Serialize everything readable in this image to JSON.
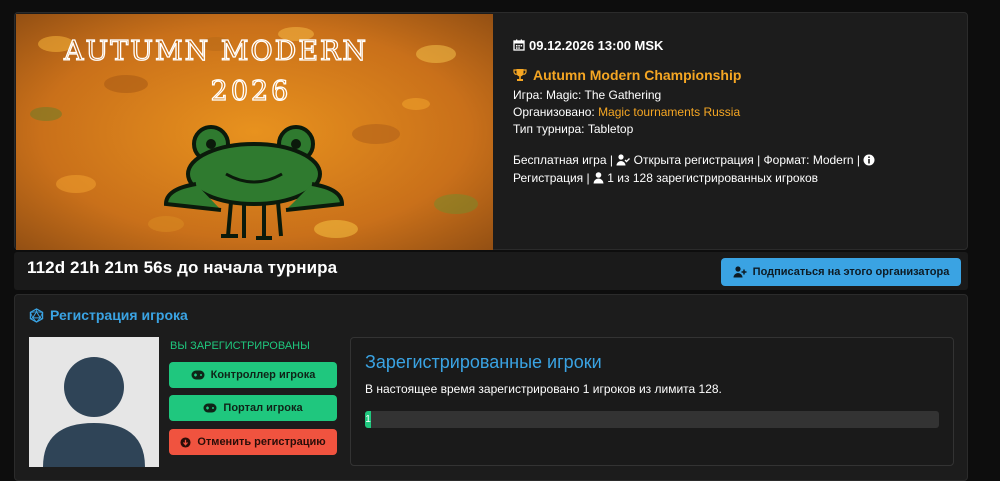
{
  "tournament": {
    "banner": {
      "title_line1": "AUTUMN MODERN",
      "title_line2": "2026",
      "frog_icon": "frog-icon"
    },
    "date": "09.12.2026 13:00 MSK",
    "name": "Autumn Modern Championship",
    "game_label": "Игра:",
    "game": "Magic: The Gathering",
    "organized_label": "Организовано:",
    "organizer": "Magic tournaments Russia",
    "type_label": "Тип турнира:",
    "type": "Tabletop",
    "meta": {
      "free": "Бесплатная игра",
      "sep1": " | ",
      "registration_open": "Открыта регистрация",
      "sep2": " | ",
      "format": "Формат: Modern",
      "sep3": " | ",
      "registration": "Регистрация",
      "sep4": " | ",
      "players": "1 из 128 зарегистрированных игроков"
    },
    "accent_color": "#f5a623"
  },
  "countdown": {
    "text": "112d 21h 21m 56s до начала турнира",
    "follow_button": "Подписаться на этого организатора"
  },
  "registration": {
    "heading": "Регистрация игрока",
    "status": "ВЫ ЗАРЕГИСТРИРОВАНЫ",
    "controller_button": "Контроллер игрока",
    "portal_button": "Портал игрока",
    "cancel_button": "Отменить регистрацию",
    "players_panel": {
      "title": "Зарегистрированные игроки",
      "text": "В настоящее время зарегистрировано 1 игроков из лимита 128.",
      "progress_label": "1",
      "registered": 1,
      "limit": 128
    }
  },
  "colors": {
    "accent_blue": "#3aa3e3",
    "accent_green": "#1fc77e",
    "danger_red": "#f0533f"
  }
}
